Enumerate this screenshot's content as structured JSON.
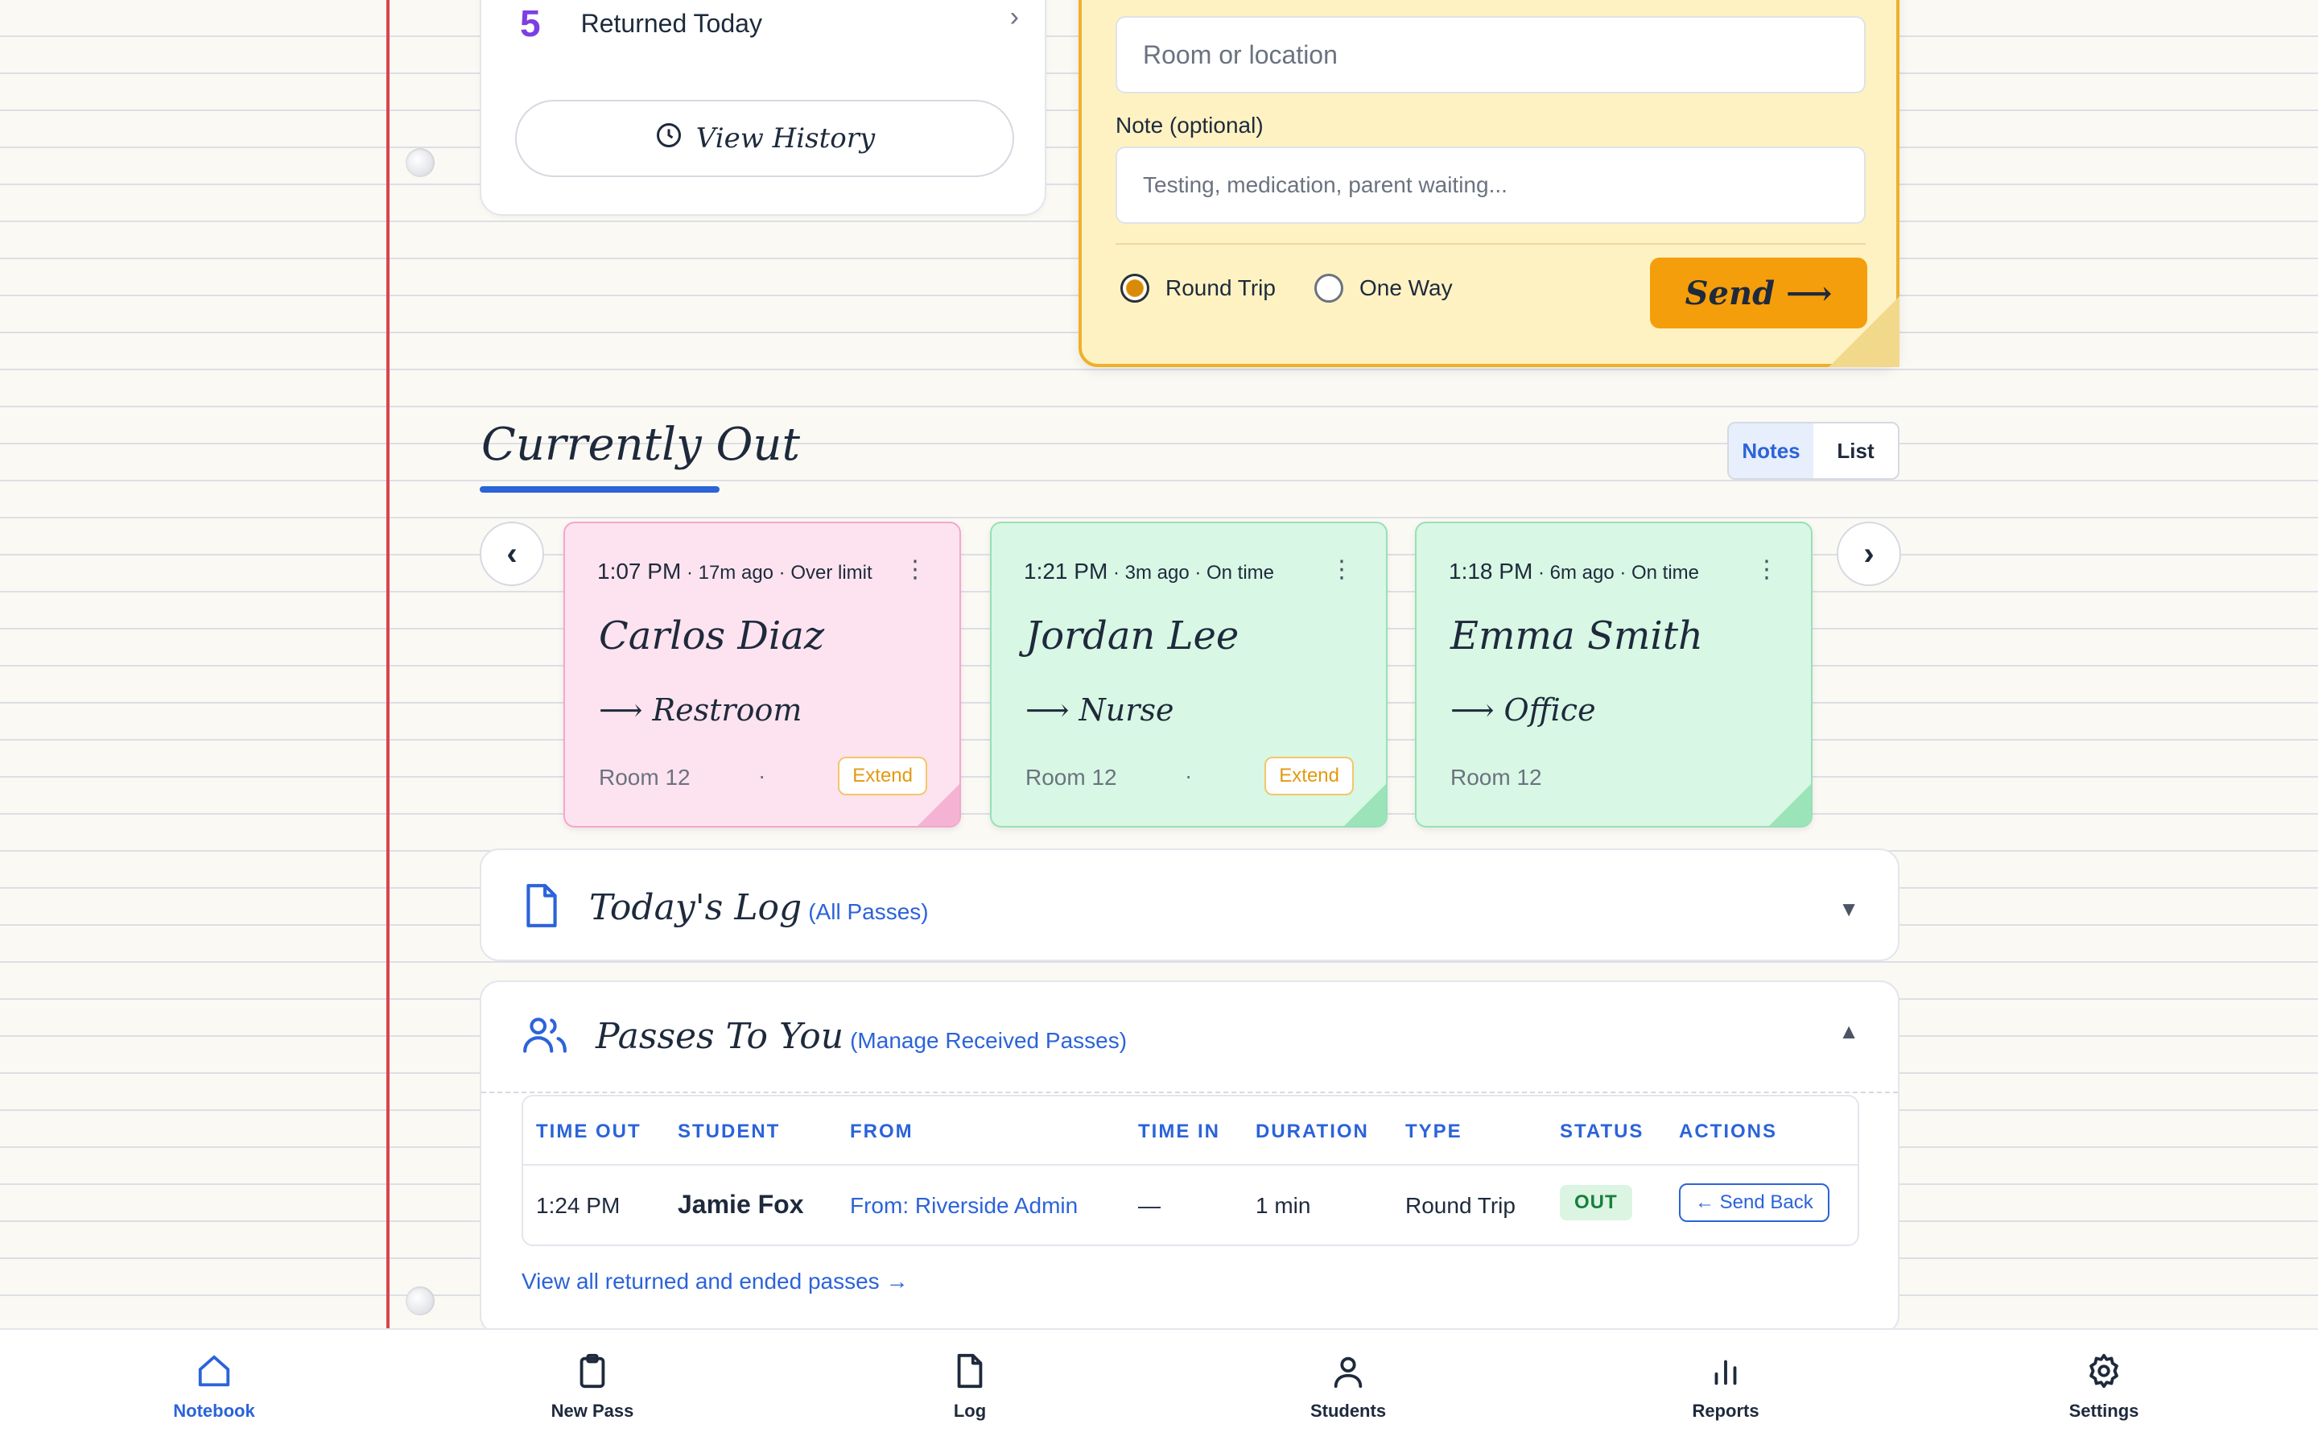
{
  "returned": {
    "count": "5",
    "label": "Returned Today",
    "history_label": "View History"
  },
  "form": {
    "room_placeholder": "Room or location",
    "note_label": "Note (optional)",
    "note_placeholder": "Testing, medication, parent waiting...",
    "options": [
      "Round Trip",
      "One Way"
    ],
    "selected_option": "Round Trip",
    "send_label": "Send ⟶"
  },
  "currently_out": {
    "title": "Currently Out",
    "view_toggle": {
      "notes": "Notes",
      "list": "List",
      "active": "Notes"
    },
    "prev_arrow": "‹",
    "next_arrow": "›",
    "cards": [
      {
        "time": "1:07 PM",
        "meta": " · 17m ago · Over limit",
        "name": "Carlos Diaz",
        "dest": "⟶ Restroom",
        "room": "Room 12",
        "dot": "·",
        "extend": "Extend",
        "color": "pink"
      },
      {
        "time": "1:21 PM",
        "meta": " · 3m ago · On time",
        "name": "Jordan Lee",
        "dest": "⟶ Nurse",
        "room": "Room 12",
        "dot": "·",
        "extend": "Extend",
        "color": "green"
      },
      {
        "time": "1:18 PM",
        "meta": " · 6m ago · On time",
        "name": "Emma Smith",
        "dest": "⟶ Office",
        "room": "Room 12",
        "color": "green"
      }
    ]
  },
  "todays_log": {
    "title": "Today's Log",
    "link": "(All Passes)",
    "caret": "▼"
  },
  "passes_to_you": {
    "title": "Passes To You",
    "link": "(Manage Received Passes)",
    "caret": "▲",
    "columns": [
      "TIME OUT",
      "STUDENT",
      "FROM",
      "TIME IN",
      "DURATION",
      "TYPE",
      "STATUS",
      "ACTIONS"
    ],
    "rows": [
      {
        "time_out": "1:24 PM",
        "student": "Jamie Fox",
        "from": "From: Riverside Admin",
        "time_in": "—",
        "duration": "1 min",
        "type": "Round Trip",
        "status": "OUT",
        "action": "← Send Back"
      }
    ],
    "view_all": "View all returned and ended passes →"
  },
  "bottom_nav": [
    {
      "label": "Notebook",
      "icon": "home-icon",
      "active": true
    },
    {
      "label": "New Pass",
      "icon": "clipboard-icon",
      "active": false
    },
    {
      "label": "Log",
      "icon": "document-icon",
      "active": false
    },
    {
      "label": "Students",
      "icon": "user-icon",
      "active": false
    },
    {
      "label": "Reports",
      "icon": "bar-chart-icon",
      "active": false
    },
    {
      "label": "Settings",
      "icon": "gear-icon",
      "active": false
    }
  ],
  "colors": {
    "accent": "#2b63d9",
    "send": "#f59e0b",
    "margin_line": "#d8474b",
    "pink_note": "#fde3ef",
    "green_note": "#d8f7e4",
    "yellow_form": "#fef2c3"
  }
}
